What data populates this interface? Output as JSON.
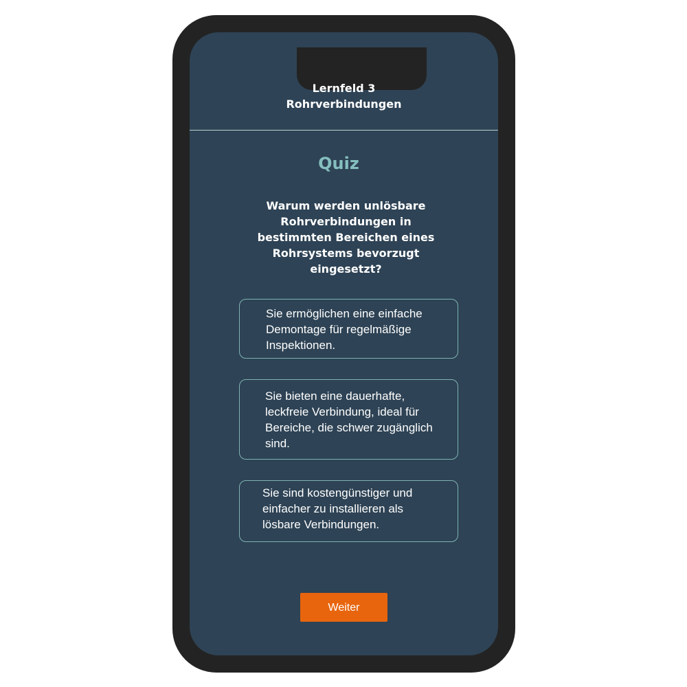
{
  "header": {
    "line1": "Lernfeld 3",
    "line2": "Rohrverbindungen"
  },
  "quiz": {
    "title": "Quiz",
    "question": "Warum werden unlösbare Rohrverbindungen in bestimmten Bereichen eines Rohrsystems bevorzugt eingesetzt?",
    "options": [
      {
        "label": "Sie ermöglichen eine einfache Demontage für regelmäßige Inspektionen."
      },
      {
        "label": "Sie bieten eine dauerhafte, leckfreie Verbindung, ideal für Bereiche, die schwer zugänglich sind."
      },
      {
        "label": "Sie sind kostengünstiger und einfacher zu installieren als lösbare Verbindungen."
      }
    ],
    "next_label": "Weiter"
  },
  "colors": {
    "screen_background": "#2e4355",
    "phone_frame": "#232323",
    "accent_title": "#85bfbf",
    "option_border": "#7fb3b3",
    "button": "#e8650e"
  }
}
